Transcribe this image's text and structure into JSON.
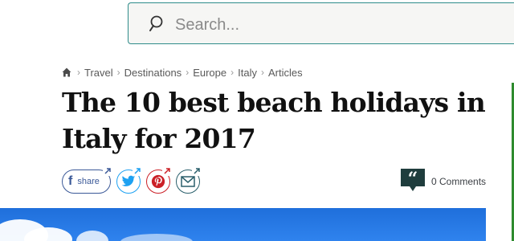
{
  "search": {
    "placeholder": "Search..."
  },
  "breadcrumb": {
    "home_icon": "home-icon",
    "separator": "›",
    "items": [
      "Travel",
      "Destinations",
      "Europe",
      "Italy",
      "Articles"
    ]
  },
  "article": {
    "title": "The 10 best beach holidays in Italy for 2017"
  },
  "share": {
    "facebook_label": "share",
    "icons": [
      "facebook-icon",
      "twitter-icon",
      "pinterest-icon",
      "email-icon"
    ]
  },
  "comments": {
    "label": "0 Comments",
    "icon": "comment-icon"
  },
  "colors": {
    "search_border": "#2f8c8a",
    "facebook": "#3b5998",
    "twitter": "#1da1f2",
    "pinterest": "#cb2027",
    "email": "#2a5f6b",
    "comments_icon": "#1f3d3d",
    "hero_sky": "#1f6fdb"
  }
}
